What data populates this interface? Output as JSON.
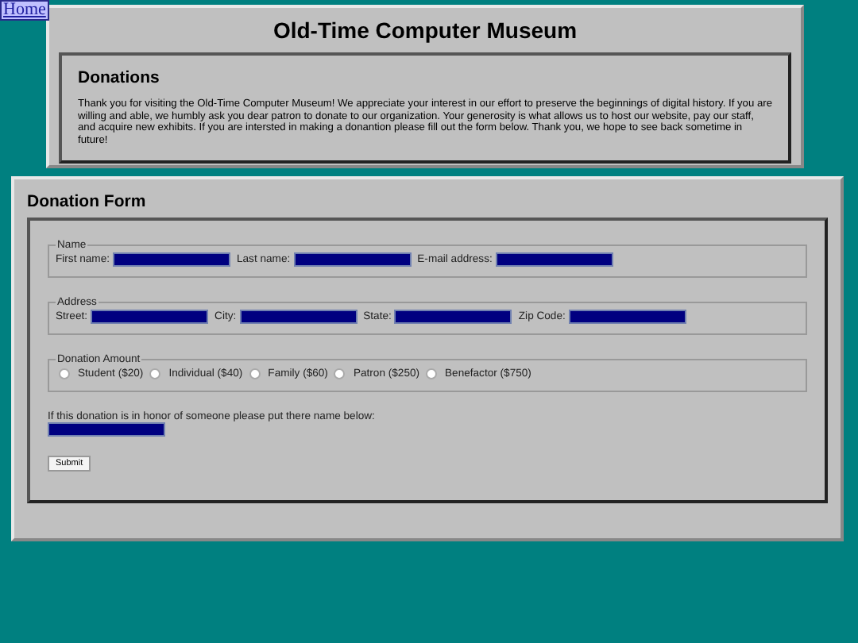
{
  "nav": {
    "home_link": "Home"
  },
  "header": {
    "title": "Old-Time Computer Museum",
    "section_title": "Donations",
    "intro": "Thank you for visiting the Old-Time Computer Museum! We appreciate your interest in our effort to preserve the beginnings of digital history. If you are willing and able, we humbly ask you dear patron to donate to our organization. Your generosity is what allows us to host our website, pay our staff, and acquire new exhibits. If you are intersted in making a donantion please fill out the form below. Thank you, we hope to see back sometime in future!"
  },
  "form": {
    "title": "Donation Form",
    "fieldsets": [
      {
        "legend": "Name",
        "kind": "fields",
        "fields": [
          "First name:",
          "Last name:",
          "E-mail address:"
        ]
      },
      {
        "legend": "Address",
        "kind": "fields",
        "fields": [
          "Street:",
          "City:",
          "State:",
          "Zip Code:"
        ]
      },
      {
        "legend": "Donation Amount",
        "kind": "radios",
        "options": [
          {
            "label": "Student ($20)",
            "selected": false
          },
          {
            "label": "Individual ($40)",
            "selected": false
          },
          {
            "label": "Family ($60)",
            "selected": false
          },
          {
            "label": "Patron ($250)",
            "selected": false
          },
          {
            "label": "Benefactor ($750)",
            "selected": false
          }
        ]
      }
    ],
    "honor_label": "If this donation is in honor of someone please put there name below:",
    "submit": "Submit"
  }
}
